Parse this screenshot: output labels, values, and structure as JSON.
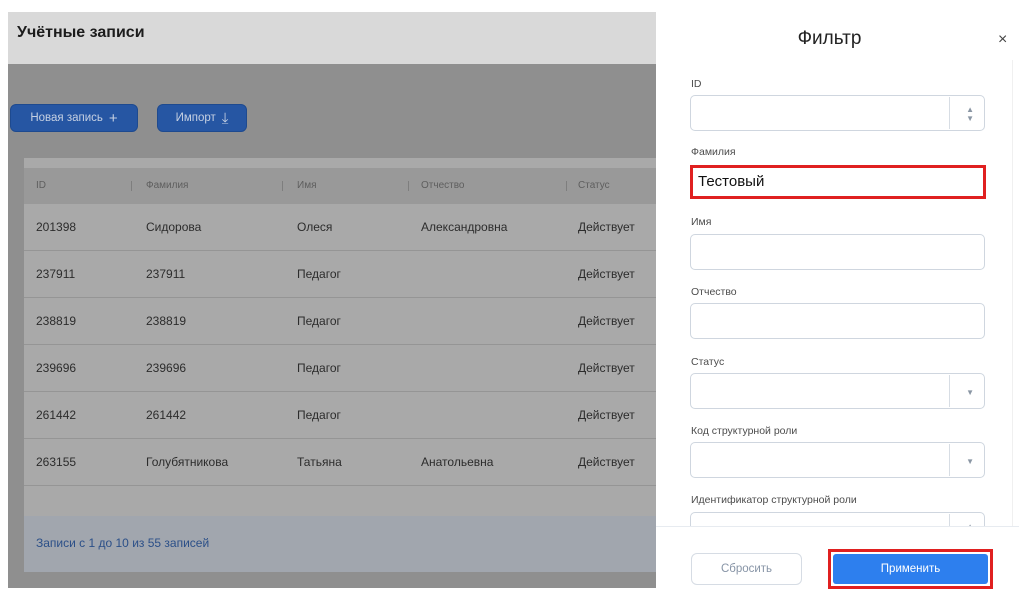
{
  "page": {
    "title": "Учётные записи",
    "new_button": "Новая запись",
    "new_icon": "+",
    "import_button": "Импорт",
    "import_icon": "⤓"
  },
  "table": {
    "headers": [
      "ID",
      "Фамилия",
      "Имя",
      "Отчество",
      "Статус"
    ],
    "rows": [
      [
        "201398",
        "Сидорова",
        "Олеся",
        "Александровна",
        "Действует"
      ],
      [
        "237911",
        "237911",
        "Педагог",
        "",
        "Действует"
      ],
      [
        "238819",
        "238819",
        "Педагог",
        "",
        "Действует"
      ],
      [
        "239696",
        "239696",
        "Педагог",
        "",
        "Действует"
      ],
      [
        "261442",
        "261442",
        "Педагог",
        "",
        "Действует"
      ],
      [
        "263155",
        "Голубятникова",
        "Татьяна",
        "Анатольевна",
        "Действует"
      ]
    ],
    "footer": "Записи с 1 до 10 из 55 записей"
  },
  "filter": {
    "title": "Фильтр",
    "close_icon": "×",
    "fields": {
      "id_label": "ID",
      "surname_label": "Фамилия",
      "surname_value": "Тестовый",
      "name_label": "Имя",
      "patronymic_label": "Отчество",
      "status_label": "Статус",
      "role_code_label": "Код структурной роли",
      "role_id_label": "Идентификатор структурной роли"
    },
    "reset_button": "Сбросить",
    "apply_button": "Применить"
  },
  "colors": {
    "highlight": "#e02020",
    "primary": "#2d7fee"
  }
}
